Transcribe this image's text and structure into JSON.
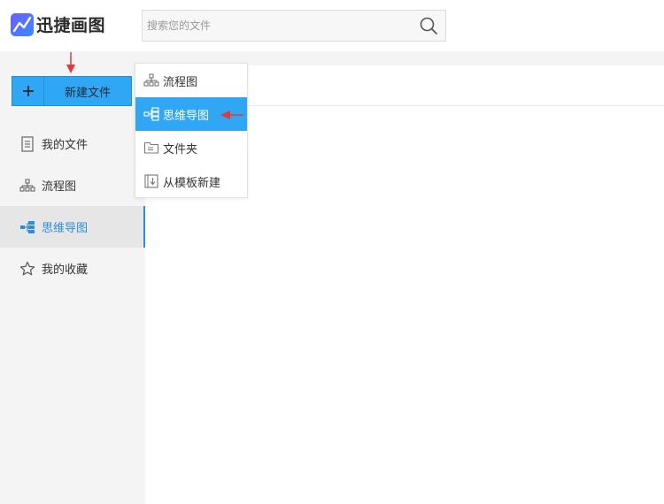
{
  "app": {
    "logo_text": "迅捷画图"
  },
  "search": {
    "placeholder": "搜索您的文件"
  },
  "sidebar": {
    "new_button_label": "新建文件",
    "items": [
      {
        "label": "我的文件",
        "icon": "document-icon",
        "active": false
      },
      {
        "label": "流程图",
        "icon": "flowchart-icon",
        "active": false
      },
      {
        "label": "思维导图",
        "icon": "mindmap-icon",
        "active": true
      },
      {
        "label": "我的收藏",
        "icon": "star-icon",
        "active": false
      }
    ]
  },
  "new_menu": {
    "items": [
      {
        "label": "流程图",
        "icon": "flowchart-icon",
        "selected": false
      },
      {
        "label": "思维导图",
        "icon": "mindmap-icon",
        "selected": true
      },
      {
        "label": "文件夹",
        "icon": "folder-icon",
        "selected": false
      },
      {
        "label": "从模板新建",
        "icon": "template-icon",
        "selected": false
      }
    ]
  },
  "colors": {
    "accent": "#2fa7f4",
    "active_text": "#2d8ee0",
    "annotation_arrow": "#e53935",
    "sidebar_bg": "#f4f4f4"
  }
}
